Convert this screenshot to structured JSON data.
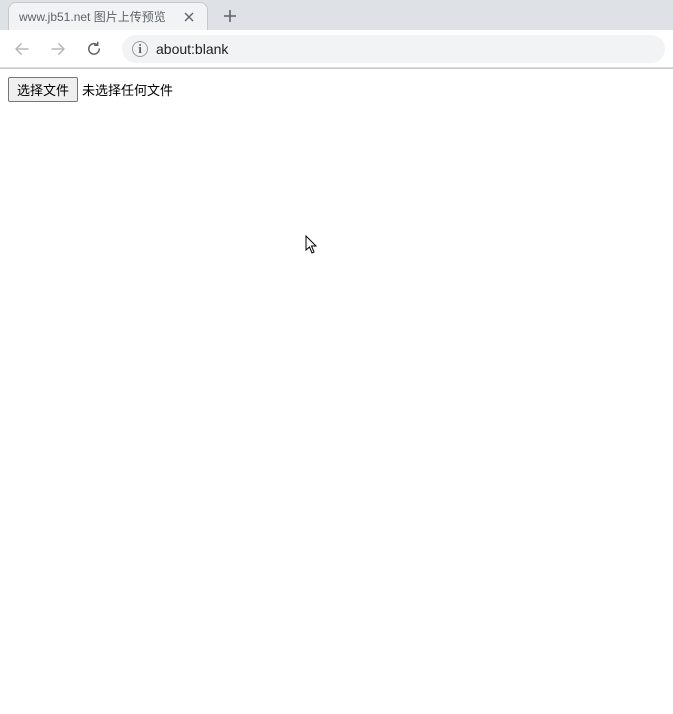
{
  "browser": {
    "tab": {
      "title": "www.jb51.net 图片上传预览"
    },
    "address": {
      "url": "about:blank"
    }
  },
  "page": {
    "file_input": {
      "button_label": "选择文件",
      "status_text": "未选择任何文件"
    }
  }
}
